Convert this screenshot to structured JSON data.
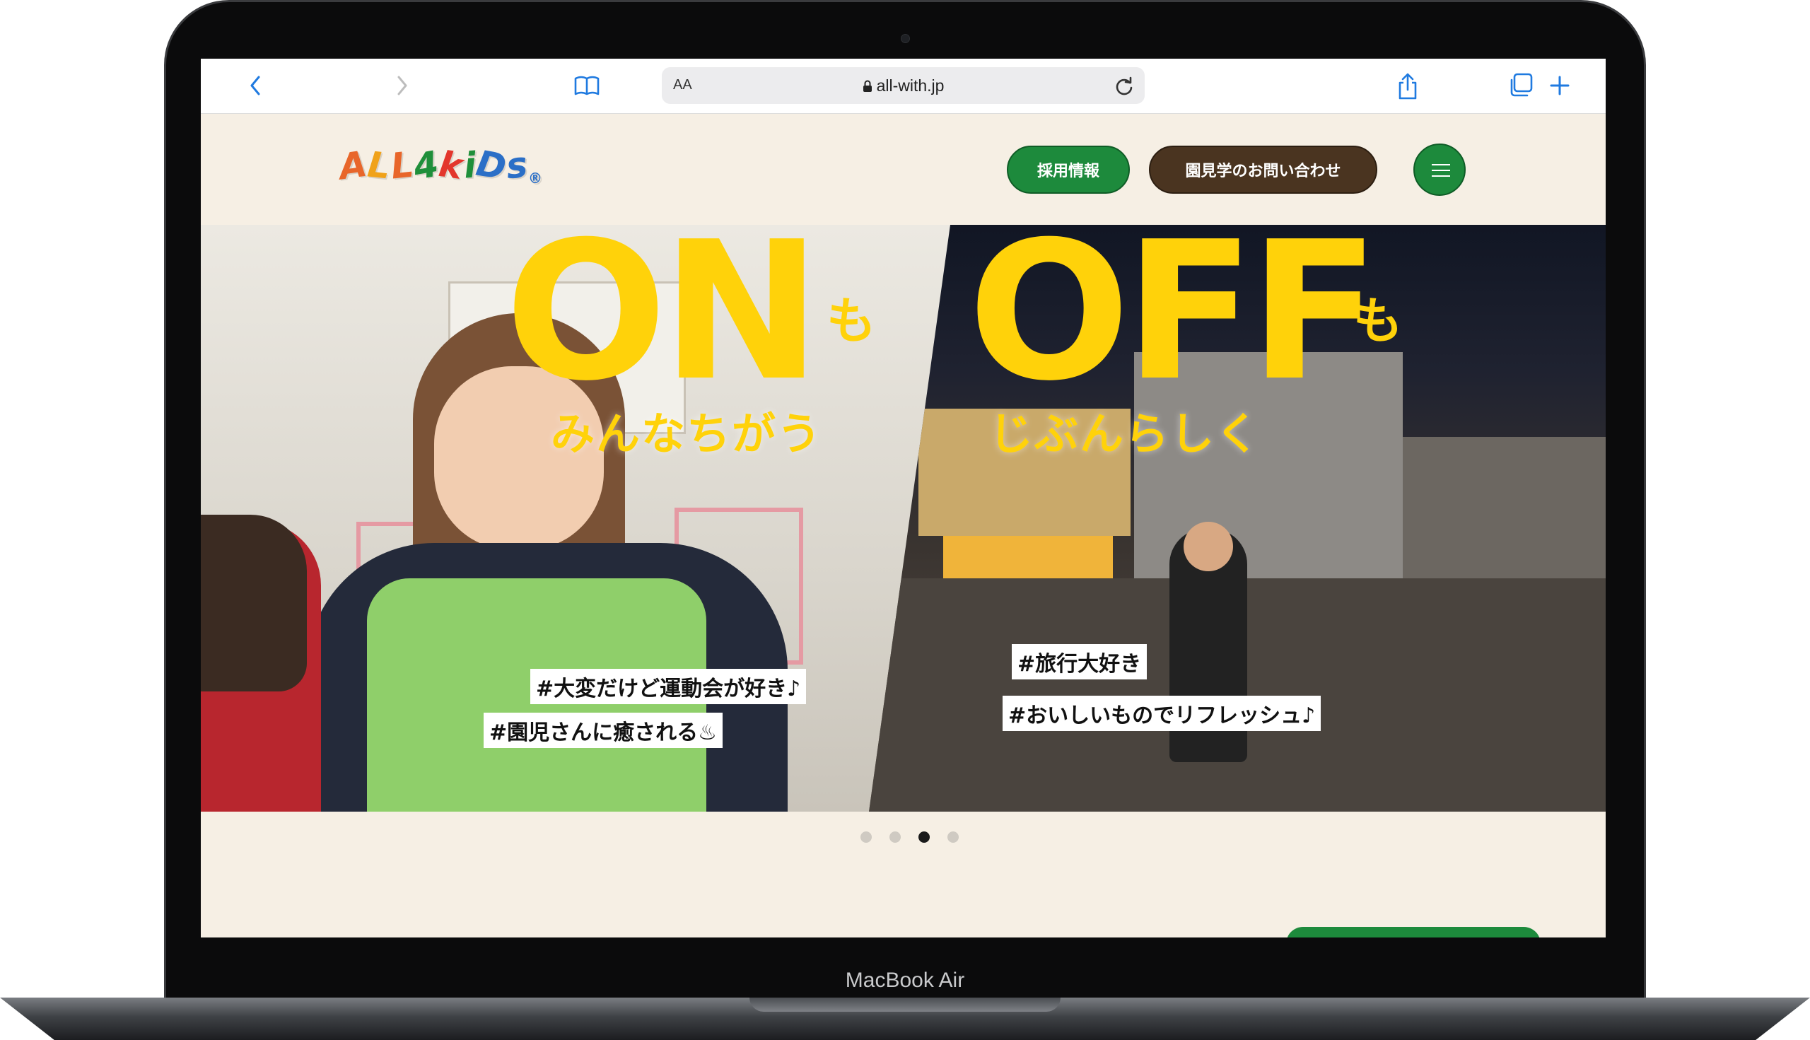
{
  "device": {
    "label": "MacBook Air"
  },
  "browser": {
    "aa_label": "AA",
    "url": "all-with.jp"
  },
  "site": {
    "logo_letters": [
      {
        "ch": "A",
        "color": "#e8662a"
      },
      {
        "ch": "L",
        "color": "#f0a21a"
      },
      {
        "ch": "L",
        "color": "#e8662a"
      },
      {
        "ch": "4",
        "color": "#1f8f3a"
      },
      {
        "ch": "k",
        "color": "#e3362c"
      },
      {
        "ch": "i",
        "color": "#1f8f3a"
      },
      {
        "ch": "D",
        "color": "#2b6fc7"
      },
      {
        "ch": "s",
        "color": "#2b6fc7"
      }
    ],
    "logo_mark": "®",
    "nav": {
      "recruit_label": "採用情報",
      "visit_label": "園見学のお問い合わせ",
      "menu_icon": "hamburger-icon"
    }
  },
  "hero": {
    "on_word": "ON",
    "on_mo": "も",
    "on_sub": "みんなちがう",
    "off_word": "OFF",
    "off_mo": "も",
    "off_sub": "じぶんらしく",
    "tags_left": [
      "#大変だけど運動会が好き♪",
      "#園児さんに癒される♨"
    ],
    "tags_right": [
      "#旅行大好き",
      "#おいしいものでリフレッシュ♪"
    ],
    "accent_color": "#ffd20a"
  },
  "carousel": {
    "total": 4,
    "active_index": 3
  }
}
